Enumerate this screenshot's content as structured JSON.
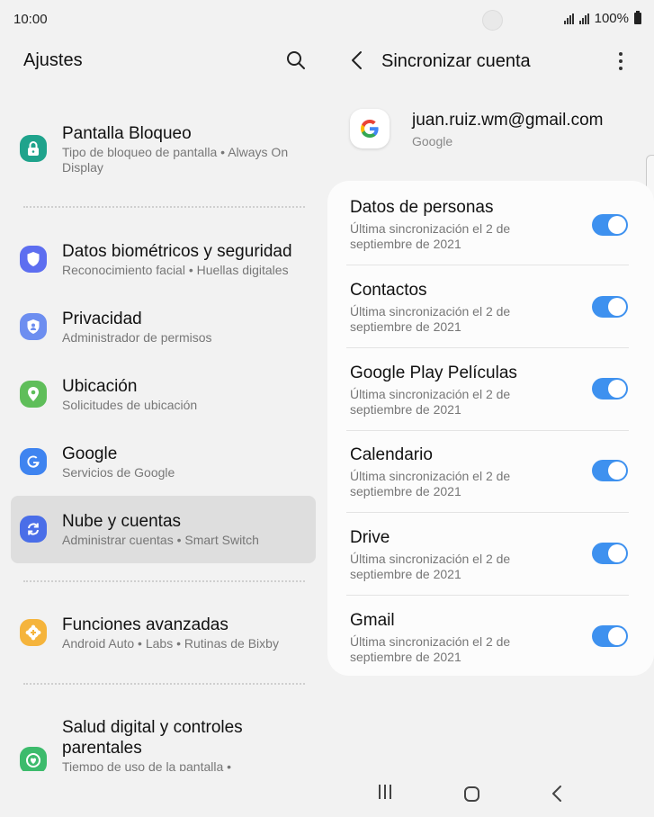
{
  "status_bar": {
    "time": "10:00",
    "battery": "100%"
  },
  "left": {
    "title": "Ajustes",
    "items": [
      {
        "title": "Pantalla Bloqueo",
        "subtitle": "Tipo de bloqueo de pantalla  •  Always On Display",
        "icon": "lock-icon",
        "color": "#1fa38c"
      },
      {
        "title": "Datos biométricos y seguridad",
        "subtitle": "Reconocimiento facial  •  Huellas digitales",
        "icon": "shield-icon",
        "color": "#5d6ef0"
      },
      {
        "title": "Privacidad",
        "subtitle": "Administrador de permisos",
        "icon": "privacy-icon",
        "color": "#6d8ef0"
      },
      {
        "title": "Ubicación",
        "subtitle": "Solicitudes de ubicación",
        "icon": "location-icon",
        "color": "#5fbe5a"
      },
      {
        "title": "Google",
        "subtitle": "Servicios de Google",
        "icon": "google-g-icon",
        "color": "#3f84f0"
      },
      {
        "title": "Nube y cuentas",
        "subtitle": "Administrar cuentas  •  Smart Switch",
        "icon": "sync-icon",
        "color": "#4a6ee8"
      },
      {
        "title": "Funciones avanzadas",
        "subtitle": "Android Auto  •  Labs  •  Rutinas de Bixby",
        "icon": "gear-plus-icon",
        "color": "#f5b43c"
      },
      {
        "title": "Salud digital y controles parentales",
        "subtitle": "Tiempo de uso de la pantalla  •",
        "icon": "digital-wellbeing-icon",
        "color": "#3dbb6c"
      }
    ]
  },
  "right": {
    "title": "Sincronizar cuenta",
    "account": {
      "email": "juan.ruiz.wm@gmail.com",
      "type": "Google"
    },
    "rows": [
      {
        "title": "Datos de personas",
        "subtitle": "Última sincronización el 2 de septiembre de 2021",
        "enabled": true
      },
      {
        "title": "Contactos",
        "subtitle": "Última sincronización el 2 de septiembre de 2021",
        "enabled": true
      },
      {
        "title": "Google Play Películas",
        "subtitle": "Última sincronización el 2 de septiembre de 2021",
        "enabled": true
      },
      {
        "title": "Calendario",
        "subtitle": "Última sincronización el 2 de septiembre de 2021",
        "enabled": true
      },
      {
        "title": "Drive",
        "subtitle": "Última sincronización el 2 de septiembre de 2021",
        "enabled": true
      },
      {
        "title": "Gmail",
        "subtitle": "Última sincronización el 2 de septiembre de 2021",
        "enabled": true
      }
    ]
  },
  "colors": {
    "toggle_on": "#3e91ef",
    "selected_bg": "#dedede",
    "background": "#f2f2f2"
  }
}
